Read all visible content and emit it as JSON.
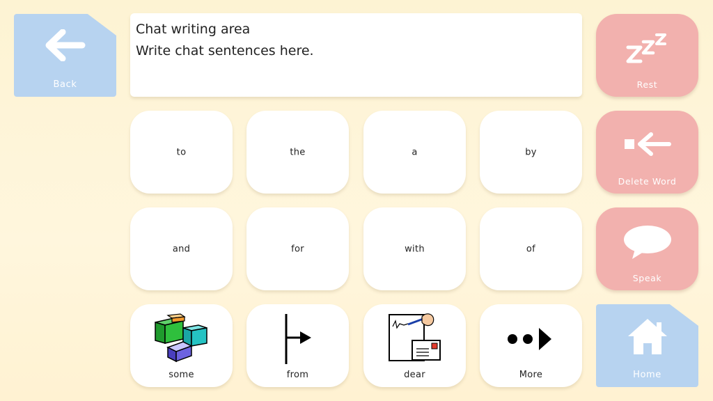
{
  "nav": {
    "back_label": "Back",
    "home_label": "Home"
  },
  "chat": {
    "title": "Chat writing area",
    "placeholder": "Write chat sentences here."
  },
  "actions": {
    "rest_label": "Rest",
    "delete_word_label": "Delete Word",
    "speak_label": "Speak"
  },
  "words": {
    "row1": [
      "to",
      "the",
      "a",
      "by"
    ],
    "row2": [
      "and",
      "for",
      "with",
      "of"
    ],
    "row3": [
      "some",
      "from",
      "dear",
      "More"
    ]
  },
  "icons": {
    "back": "arrow-left-icon",
    "rest": "sleep-zzz-icon",
    "delete": "delete-word-arrow-icon",
    "speak": "speech-bubble-icon",
    "home": "house-icon",
    "some": "colored-blocks-icon",
    "from": "from-arrow-icon",
    "dear": "letter-writing-icon",
    "more": "more-arrow-icon"
  },
  "colors": {
    "background": "#fdf3d3",
    "action_tile": "#f2b1ae",
    "nav_tile": "#b7d3f0",
    "word_tile": "#ffffff"
  }
}
